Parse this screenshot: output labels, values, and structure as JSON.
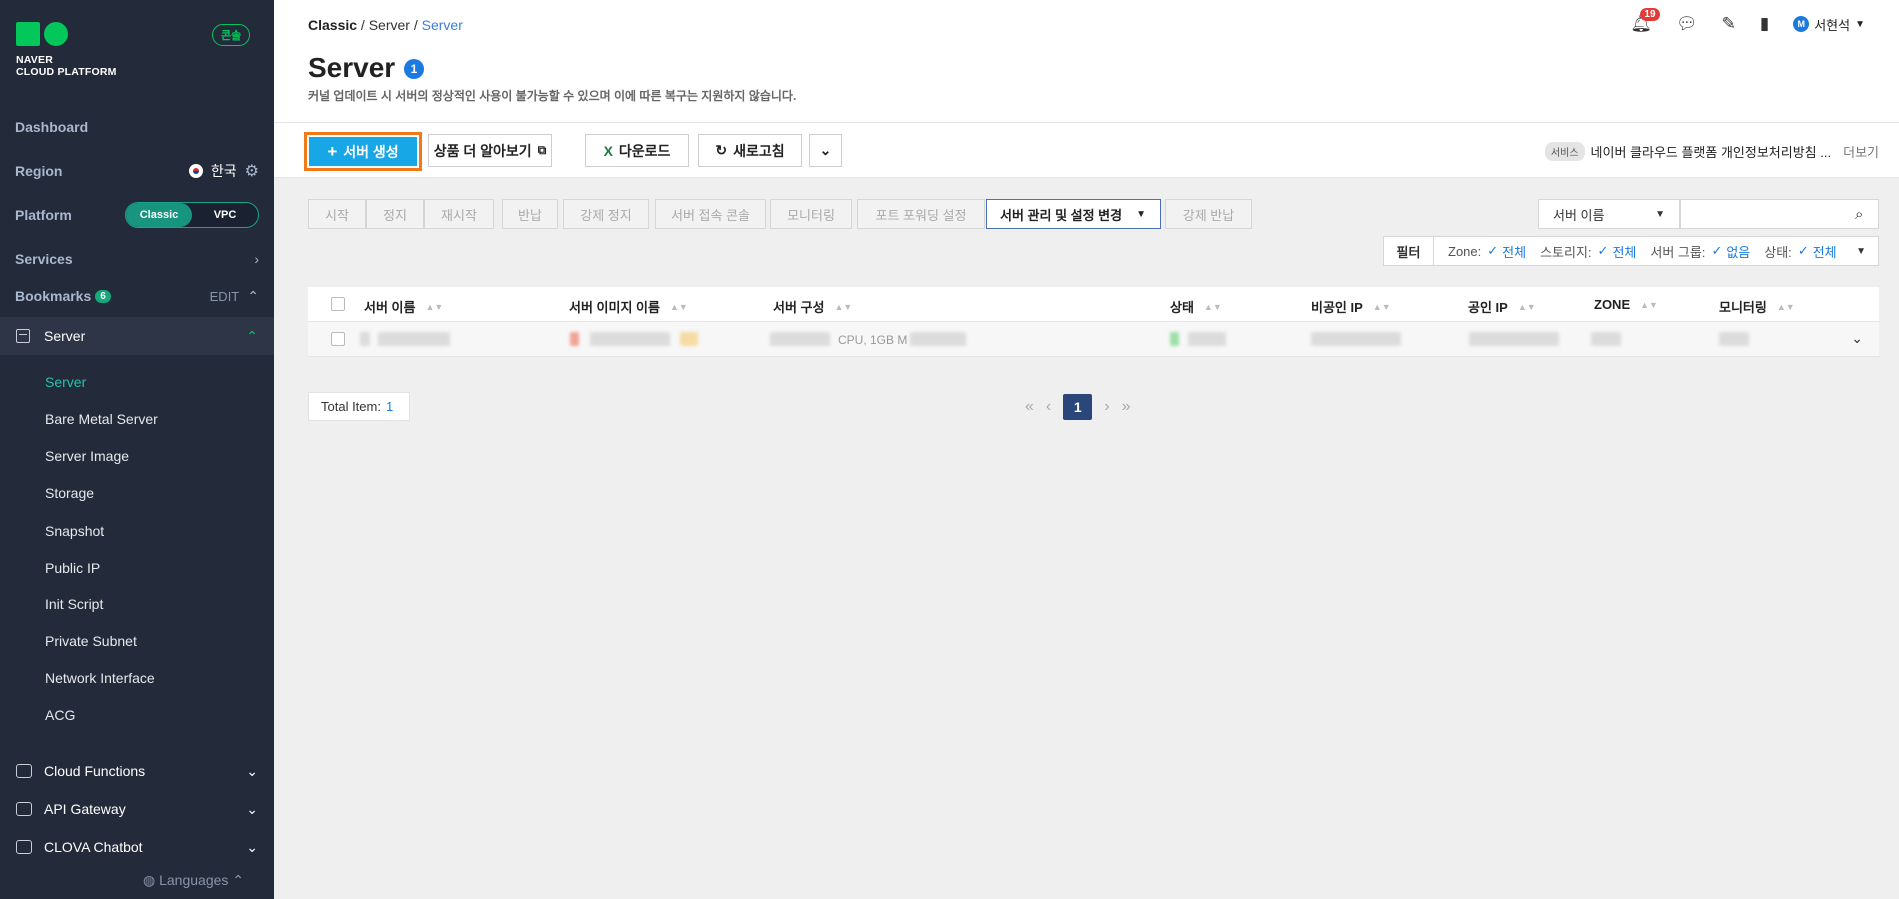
{
  "sidebar": {
    "logo_line1": "NAVER",
    "logo_line2": "CLOUD PLATFORM",
    "console_badge": "콘솔",
    "dashboard": "Dashboard",
    "region_label": "Region",
    "region_value": "한국",
    "platform_label": "Platform",
    "platform_options": [
      "Classic",
      "VPC"
    ],
    "platform_selected": "Classic",
    "services_label": "Services",
    "bookmarks_label": "Bookmarks",
    "bookmarks_count": "6",
    "bookmarks_edit": "EDIT",
    "server_group": "Server",
    "server_items": [
      "Server",
      "Bare Metal Server",
      "Server Image",
      "Storage",
      "Snapshot",
      "Public IP",
      "Init Script",
      "Private Subnet",
      "Network Interface",
      "ACG"
    ],
    "active_item": "Server",
    "groups": [
      "Cloud Functions",
      "API Gateway",
      "CLOVA Chatbot"
    ],
    "languages": "Languages"
  },
  "header": {
    "breadcrumb": [
      "Classic",
      "Server",
      "Server"
    ],
    "title": "Server",
    "title_count": "1",
    "subtitle": "커널 업데이트 시 서버의 정상적인 사용이 불가능할 수 있으며 이에 따른 복구는 지원하지 않습니다.",
    "notification_count": "19",
    "user_initial": "M",
    "user_name": "서현석"
  },
  "actions": {
    "create": "서버 생성",
    "learn_more": "상품 더 알아보기",
    "download": "다운로드",
    "refresh": "새로고침",
    "notice_tag": "서비스",
    "notice_text": "네이버 클라우드 플랫폼 개인정보처리방침 ...",
    "notice_more": "더보기"
  },
  "commands": [
    "시작",
    "정지",
    "재시작",
    "반납",
    "강제 정지",
    "서버 접속 콘솔",
    "모니터링",
    "포트 포워딩 설정",
    "서버 관리 및 설정 변경",
    "강제 반납"
  ],
  "search": {
    "field": "서버 이름",
    "placeholder": ""
  },
  "filter": {
    "button": "필터",
    "zone_label": "Zone:",
    "zone_value": "전체",
    "storage_label": "스토리지:",
    "storage_value": "전체",
    "group_label": "서버 그룹:",
    "group_value": "없음",
    "status_label": "상태:",
    "status_value": "전체"
  },
  "table": {
    "columns": [
      "서버 이름",
      "서버 이미지 이름",
      "서버 구성",
      "상태",
      "비공인 IP",
      "공인 IP",
      "ZONE",
      "모니터링"
    ],
    "row_partial": "CPU, 1GB M"
  },
  "pagination": {
    "total_label": "Total Item:",
    "total_count": "1",
    "current_page": "1"
  }
}
